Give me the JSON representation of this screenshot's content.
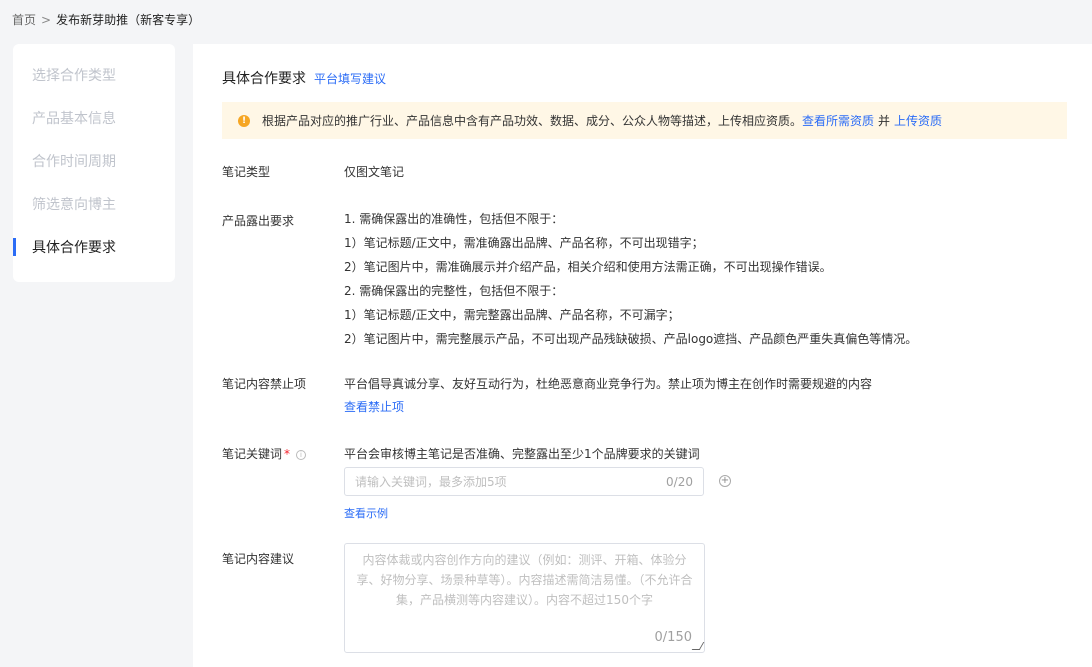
{
  "breadcrumb": {
    "home": "首页",
    "separator": ">",
    "current": "发布新芽助推（新客专享）"
  },
  "sidebar": {
    "items": [
      {
        "label": "选择合作类型",
        "active": false
      },
      {
        "label": "产品基本信息",
        "active": false
      },
      {
        "label": "合作时间周期",
        "active": false
      },
      {
        "label": "筛选意向博主",
        "active": false
      },
      {
        "label": "具体合作要求",
        "active": true
      }
    ]
  },
  "section": {
    "title": "具体合作要求",
    "suggest_link": "平台填写建议"
  },
  "notice": {
    "text": "根据产品对应的推广行业、产品信息中含有产品功效、数据、成分、公众人物等描述，上传相应资质。",
    "link_view": "查看所需资质",
    "and": "并",
    "link_upload": "上传资质"
  },
  "note_type": {
    "label": "笔记类型",
    "value": "仅图文笔记"
  },
  "exposure": {
    "label": "产品露出要求",
    "lines": [
      "1. 需确保露出的准确性，包括但不限于：",
      "1）笔记标题/正文中，需准确露出品牌、产品名称，不可出现错字；",
      "2）笔记图片中，需准确展示并介绍产品，相关介绍和使用方法需正确，不可出现操作错误。",
      "2. 需确保露出的完整性，包括但不限于：",
      "1）笔记标题/正文中，需完整露出品牌、产品名称，不可漏字；",
      "2）笔记图片中，需完整展示产品，不可出现产品残缺破损、产品logo遮挡、产品颜色严重失真偏色等情况。"
    ]
  },
  "banned": {
    "label": "笔记内容禁止项",
    "text": "平台倡导真诚分享、友好互动行为，杜绝恶意商业竞争行为。禁止项为博主在创作时需要规避的内容",
    "link": "查看禁止项"
  },
  "keywords": {
    "label": "笔记关键词",
    "required_mark": "*",
    "hint": "平台会审核博主笔记是否准确、完整露出至少1个品牌要求的关键词",
    "placeholder": "请输入关键词，最多添加5项",
    "counter": "0/20",
    "example_link": "查看示例"
  },
  "suggestion": {
    "label": "笔记内容建议",
    "placeholder": "内容体裁或内容创作方向的建议（例如：测评、开箱、体验分享、好物分享、场景种草等）。内容描述需简洁易懂。（不允许合集，产品横测等内容建议）。内容不超过150个字",
    "counter": "0/150"
  },
  "colors": {
    "accent": "#2b6cf6",
    "warning": "#f6a623",
    "notice_bg": "#fff7e6"
  }
}
